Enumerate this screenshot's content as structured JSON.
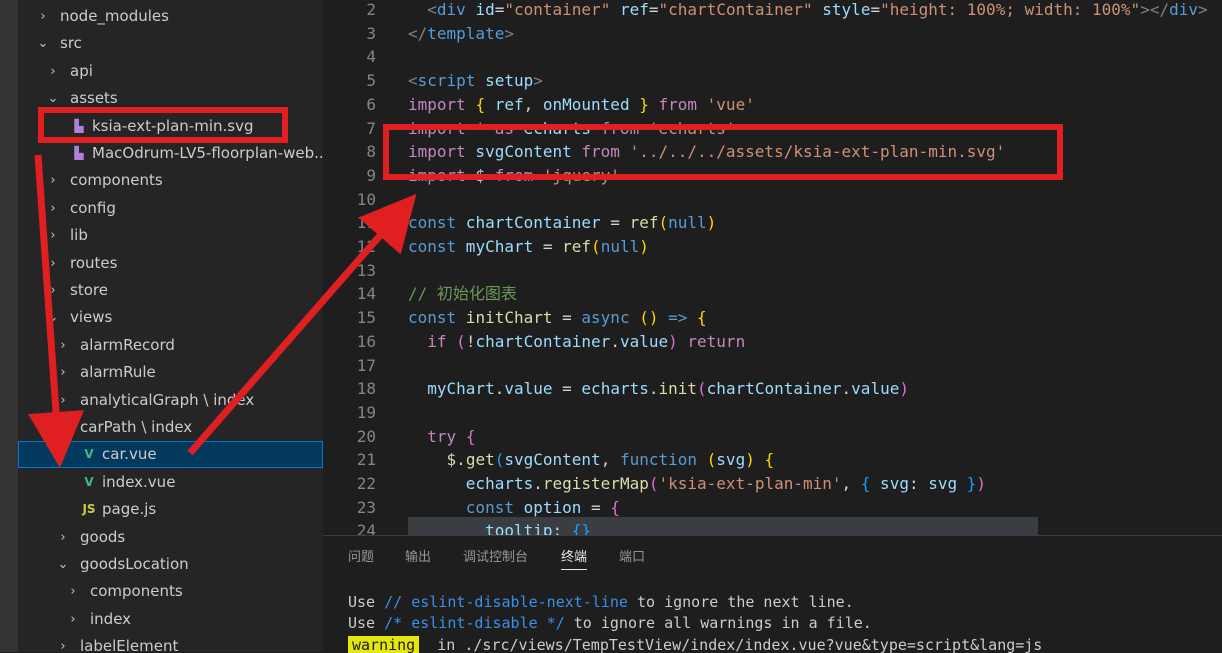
{
  "explorer": {
    "rows": [
      {
        "label": "node_modules",
        "chev": "›",
        "indent": 0
      },
      {
        "label": "src",
        "chev": "⌄",
        "indent": 0
      },
      {
        "label": "api",
        "chev": "›",
        "indent": 1
      },
      {
        "label": "assets",
        "chev": "⌄",
        "indent": 1
      },
      {
        "label": "ksia-ext-plan-min.svg",
        "icon": "svg",
        "indent": 2
      },
      {
        "label": "MacOdrum-LV5-floorplan-web....",
        "icon": "svg",
        "indent": 2
      },
      {
        "label": "components",
        "chev": "›",
        "indent": 1
      },
      {
        "label": "config",
        "chev": "›",
        "indent": 1
      },
      {
        "label": "lib",
        "chev": "›",
        "indent": 1
      },
      {
        "label": "routes",
        "chev": "›",
        "indent": 1
      },
      {
        "label": "store",
        "chev": "›",
        "indent": 1
      },
      {
        "label": "views",
        "chev": "⌄",
        "indent": 1
      },
      {
        "label": "alarmRecord",
        "chev": "›",
        "indent": 2
      },
      {
        "label": "alarmRule",
        "chev": "›",
        "indent": 2
      },
      {
        "label": "analyticalGraph \\ index",
        "chev": "›",
        "indent": 2
      },
      {
        "label": "carPath \\ index",
        "chev": "⌄",
        "indent": 2
      },
      {
        "label": "car.vue",
        "icon": "vue",
        "indent": 3,
        "selected": true
      },
      {
        "label": "index.vue",
        "icon": "vue",
        "indent": 3
      },
      {
        "label": "page.js",
        "icon": "js",
        "indent": 3
      },
      {
        "label": "goods",
        "chev": "›",
        "indent": 2
      },
      {
        "label": "goodsLocation",
        "chev": "⌄",
        "indent": 2
      },
      {
        "label": "components",
        "chev": "›",
        "indent": 3
      },
      {
        "label": "index",
        "chev": "›",
        "indent": 3
      },
      {
        "label": "labelElement",
        "chev": "›",
        "indent": 2
      }
    ],
    "icons": {
      "svg": "svg-file-icon",
      "vue": "vue-file-icon",
      "js": "js-file-icon"
    }
  },
  "editor": {
    "lines": [
      {
        "n": "2",
        "parts": [
          [
            "pl",
            "  "
          ],
          [
            "gray",
            "<"
          ],
          [
            "tg",
            "div"
          ],
          [
            "pl",
            " "
          ],
          [
            "at",
            "id"
          ],
          [
            "pl",
            "="
          ],
          [
            "str",
            "\"container\""
          ],
          [
            "pl",
            " "
          ],
          [
            "at",
            "ref"
          ],
          [
            "pl",
            "="
          ],
          [
            "str",
            "\"chartContainer\""
          ],
          [
            "pl",
            " "
          ],
          [
            "at",
            "style"
          ],
          [
            "pl",
            "="
          ],
          [
            "str",
            "\"height: 100%; width: 100%\""
          ],
          [
            "gray",
            "></"
          ],
          [
            "tg",
            "div"
          ],
          [
            "gray",
            ">"
          ]
        ]
      },
      {
        "n": "3",
        "parts": [
          [
            "gray",
            "</"
          ],
          [
            "tg",
            "template"
          ],
          [
            "gray",
            ">"
          ]
        ]
      },
      {
        "n": "4",
        "parts": []
      },
      {
        "n": "5",
        "parts": [
          [
            "gray",
            "<"
          ],
          [
            "tg",
            "script"
          ],
          [
            "pl",
            " "
          ],
          [
            "at",
            "setup"
          ],
          [
            "gray",
            ">"
          ]
        ]
      },
      {
        "n": "6",
        "parts": [
          [
            "kw2",
            "import"
          ],
          [
            "pl",
            " "
          ],
          [
            "br1",
            "{"
          ],
          [
            "var",
            " ref"
          ],
          [
            "pl",
            ", "
          ],
          [
            "var",
            "onMounted"
          ],
          [
            "pl",
            " "
          ],
          [
            "br1",
            "}"
          ],
          [
            "kw2",
            " from"
          ],
          [
            "str",
            " 'vue'"
          ]
        ]
      },
      {
        "n": "7",
        "parts": [
          [
            "kw2",
            "import"
          ],
          [
            "pl",
            " * "
          ],
          [
            "kw2",
            "as"
          ],
          [
            "var",
            " echarts"
          ],
          [
            "kw2",
            " from"
          ],
          [
            "str",
            " 'echarts'"
          ]
        ]
      },
      {
        "n": "8",
        "parts": [
          [
            "kw2",
            "import"
          ],
          [
            "var",
            " svgContent"
          ],
          [
            "kw2",
            " from"
          ],
          [
            "str",
            " '../../../assets/ksia-ext-plan-min.svg'"
          ]
        ]
      },
      {
        "n": "9",
        "parts": [
          [
            "kw2",
            "import"
          ],
          [
            "var",
            " $"
          ],
          [
            "kw2",
            " from"
          ],
          [
            "str",
            " 'jquery'"
          ]
        ]
      },
      {
        "n": "10",
        "parts": []
      },
      {
        "n": "11",
        "parts": [
          [
            "kw",
            "const"
          ],
          [
            "var",
            " chartContainer"
          ],
          [
            "pl",
            " = "
          ],
          [
            "fn",
            "ref"
          ],
          [
            "br1",
            "("
          ],
          [
            "kw",
            "null"
          ],
          [
            "br1",
            ")"
          ]
        ]
      },
      {
        "n": "12",
        "parts": [
          [
            "kw",
            "const"
          ],
          [
            "var",
            " myChart"
          ],
          [
            "pl",
            " = "
          ],
          [
            "fn",
            "ref"
          ],
          [
            "br1",
            "("
          ],
          [
            "kw",
            "null"
          ],
          [
            "br1",
            ")"
          ]
        ]
      },
      {
        "n": "13",
        "parts": []
      },
      {
        "n": "14",
        "parts": [
          [
            "cm",
            "// 初始化图表"
          ]
        ]
      },
      {
        "n": "15",
        "parts": [
          [
            "kw",
            "const"
          ],
          [
            "fn",
            " initChart"
          ],
          [
            "pl",
            " = "
          ],
          [
            "kw",
            "async"
          ],
          [
            "pl",
            " "
          ],
          [
            "br1",
            "()"
          ],
          [
            "kw",
            " =>"
          ],
          [
            "pl",
            " "
          ],
          [
            "br1",
            "{"
          ]
        ]
      },
      {
        "n": "16",
        "parts": [
          [
            "pl",
            "  "
          ],
          [
            "kw2",
            "if"
          ],
          [
            "pl",
            " "
          ],
          [
            "br2",
            "("
          ],
          [
            "pl",
            "!"
          ],
          [
            "var",
            "chartContainer"
          ],
          [
            "pl",
            "."
          ],
          [
            "var",
            "value"
          ],
          [
            "br2",
            ")"
          ],
          [
            "kw2",
            " return"
          ]
        ]
      },
      {
        "n": "17",
        "parts": []
      },
      {
        "n": "18",
        "parts": [
          [
            "pl",
            "  "
          ],
          [
            "var",
            "myChart"
          ],
          [
            "pl",
            "."
          ],
          [
            "var",
            "value"
          ],
          [
            "pl",
            " = "
          ],
          [
            "var",
            "echarts"
          ],
          [
            "pl",
            "."
          ],
          [
            "fn",
            "init"
          ],
          [
            "br2",
            "("
          ],
          [
            "var",
            "chartContainer"
          ],
          [
            "pl",
            "."
          ],
          [
            "var",
            "value"
          ],
          [
            "br2",
            ")"
          ]
        ]
      },
      {
        "n": "19",
        "parts": []
      },
      {
        "n": "20",
        "parts": [
          [
            "pl",
            "  "
          ],
          [
            "kw2",
            "try"
          ],
          [
            "pl",
            " "
          ],
          [
            "br2",
            "{"
          ]
        ]
      },
      {
        "n": "21",
        "parts": [
          [
            "pl",
            "    "
          ],
          [
            "fn",
            "$"
          ],
          [
            "pl",
            "."
          ],
          [
            "fn",
            "get"
          ],
          [
            "br3",
            "("
          ],
          [
            "var",
            "svgContent"
          ],
          [
            "pl",
            ", "
          ],
          [
            "kw",
            "function"
          ],
          [
            "pl",
            " "
          ],
          [
            "br1",
            "("
          ],
          [
            "var",
            "svg"
          ],
          [
            "br1",
            ")"
          ],
          [
            "pl",
            " "
          ],
          [
            "br1",
            "{"
          ]
        ]
      },
      {
        "n": "22",
        "parts": [
          [
            "pl",
            "      "
          ],
          [
            "var",
            "echarts"
          ],
          [
            "pl",
            "."
          ],
          [
            "fn",
            "registerMap"
          ],
          [
            "br2",
            "("
          ],
          [
            "str",
            "'ksia-ext-plan-min'"
          ],
          [
            "pl",
            ", "
          ],
          [
            "br3",
            "{"
          ],
          [
            "var",
            " svg"
          ],
          [
            "pl",
            ": "
          ],
          [
            "var",
            "svg"
          ],
          [
            "pl",
            " "
          ],
          [
            "br3",
            "}"
          ],
          [
            "br2",
            ")"
          ]
        ]
      },
      {
        "n": "23",
        "parts": [
          [
            "pl",
            "      "
          ],
          [
            "kw",
            "const"
          ],
          [
            "var",
            " option"
          ],
          [
            "pl",
            " = "
          ],
          [
            "br2",
            "{"
          ]
        ]
      },
      {
        "n": "24",
        "parts": [
          [
            "pl",
            "        "
          ],
          [
            "var",
            "tooltip"
          ],
          [
            "pl",
            ": "
          ],
          [
            "br3",
            "{}"
          ]
        ]
      }
    ]
  },
  "panel": {
    "tabs": [
      "问题",
      "输出",
      "调试控制台",
      "终端",
      "端口"
    ],
    "active_tab": "终端",
    "terminal": {
      "l1_a": "Use ",
      "l1_b": "// eslint-disable-next-line",
      "l1_c": " to ignore the next line.",
      "l2_a": "Use ",
      "l2_b": "/* eslint-disable */",
      "l2_c": " to ignore all warnings in a file.",
      "warn": "warning",
      "warn_rest": "  in ./src/views/TempTestView/index/index.vue?vue&type=script&lang=js"
    }
  },
  "annotations": {
    "box_color": "#e02020"
  }
}
